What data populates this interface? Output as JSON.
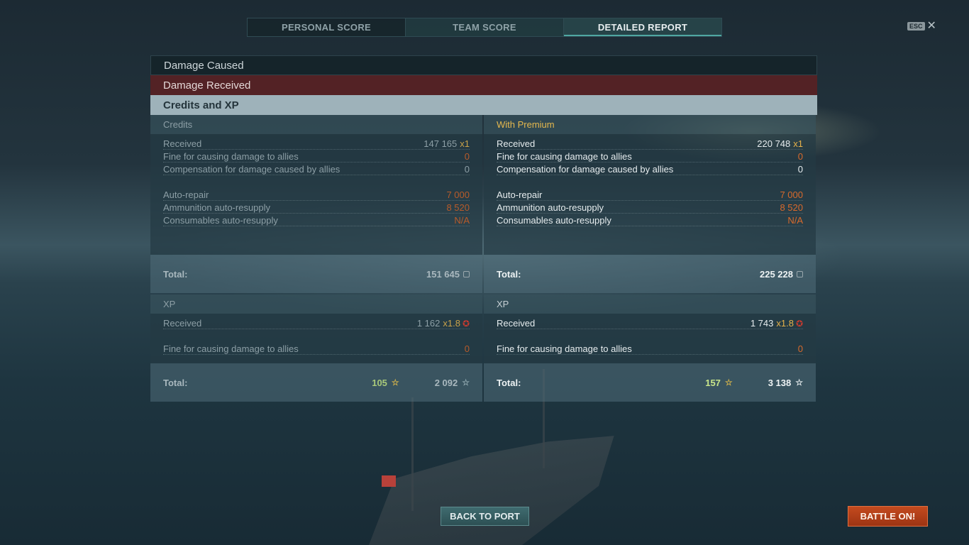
{
  "tabs": {
    "personal": "PERSONAL SCORE",
    "team": "TEAM SCORE",
    "detailed": "DETAILED REPORT"
  },
  "esc_key": "ESC",
  "sections": {
    "damage_caused": "Damage Caused",
    "damage_received": "Damage Received",
    "credits_xp": "Credits and XP"
  },
  "credits": {
    "header": "Credits",
    "received_label": "Received",
    "received_value": "147 165",
    "received_mult": "x1",
    "fine_label": "Fine for causing damage to allies",
    "fine_value": "0",
    "comp_label": "Compensation for damage caused by allies",
    "comp_value": "0",
    "repair_label": "Auto-repair",
    "repair_value": "7 000",
    "ammo_label": "Ammunition auto-resupply",
    "ammo_value": "8 520",
    "cons_label": "Consumables auto-resupply",
    "cons_value": "N/A",
    "total_label": "Total:",
    "total_value": "151 645"
  },
  "premium": {
    "header": "With Premium",
    "received_label": "Received",
    "received_value": "220 748",
    "received_mult": "x1",
    "fine_label": "Fine for causing damage to allies",
    "fine_value": "0",
    "comp_label": "Compensation for damage caused by allies",
    "comp_value": "0",
    "repair_label": "Auto-repair",
    "repair_value": "7 000",
    "ammo_label": "Ammunition auto-resupply",
    "ammo_value": "8 520",
    "cons_label": "Consumables auto-resupply",
    "cons_value": "N/A",
    "total_label": "Total:",
    "total_value": "225 228"
  },
  "xp": {
    "header": "XP",
    "received_label": "Received",
    "received_value": "1 162",
    "received_mult": "x1.8",
    "fine_label": "Fine for causing damage to allies",
    "fine_value": "0",
    "total_label": "Total:",
    "total_free": "105",
    "total_value": "2 092"
  },
  "xp_premium": {
    "header": "XP",
    "received_label": "Received",
    "received_value": "1 743",
    "received_mult": "x1.8",
    "fine_label": "Fine for causing damage to allies",
    "fine_value": "0",
    "total_label": "Total:",
    "total_free": "157",
    "total_value": "3 138"
  },
  "buttons": {
    "back": "BACK TO PORT",
    "battle": "BATTLE ON!"
  },
  "icons": {
    "close": "close-icon",
    "credits": "credits-icon",
    "star": "star-icon",
    "premium_star": "premium-star-icon"
  }
}
